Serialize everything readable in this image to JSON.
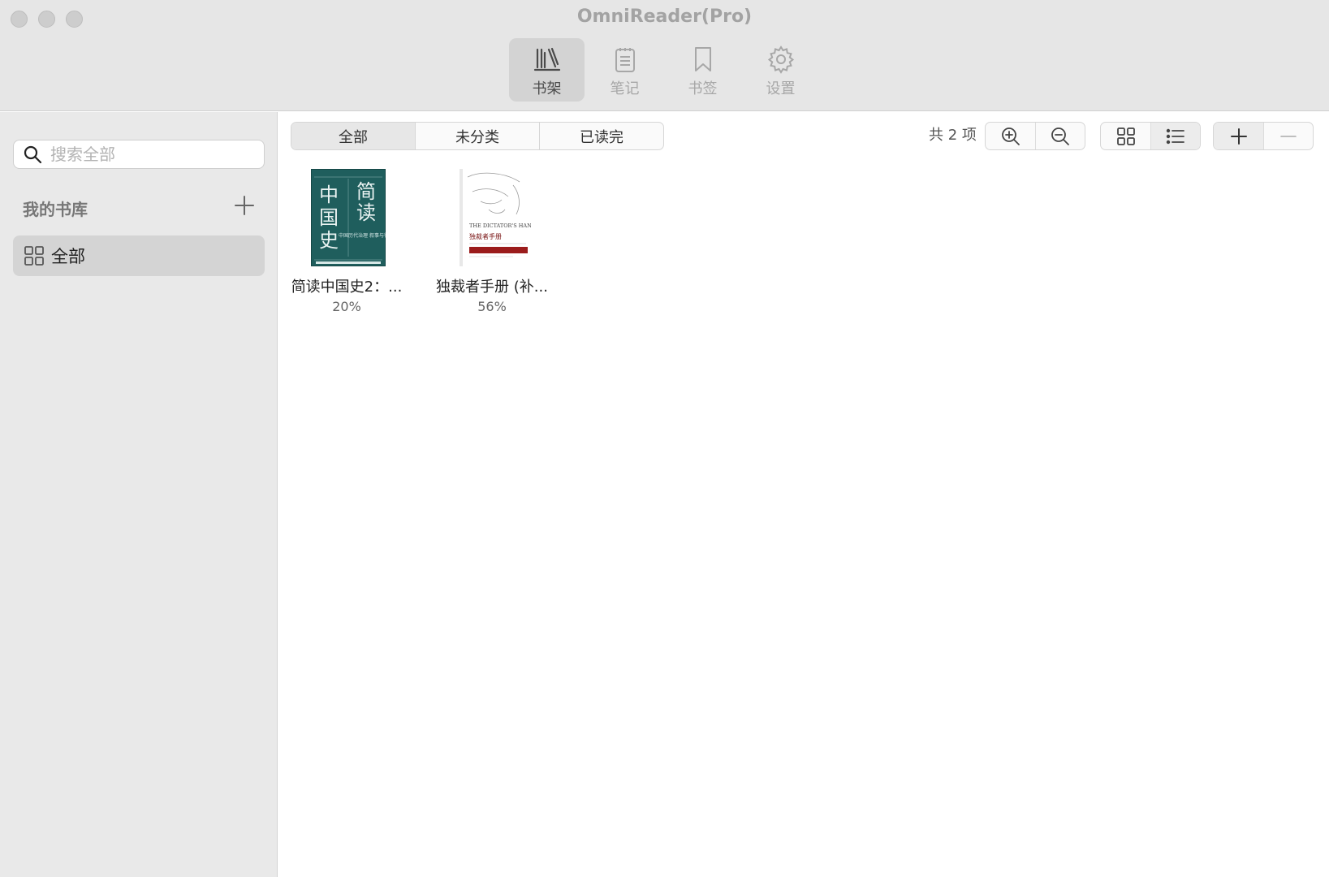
{
  "window": {
    "title": "OmniReader(Pro)"
  },
  "toolbar": {
    "tabs": [
      {
        "label": "书架",
        "icon": "bookshelf-icon",
        "active": true
      },
      {
        "label": "笔记",
        "icon": "notes-icon",
        "active": false
      },
      {
        "label": "书签",
        "icon": "bookmark-icon",
        "active": false
      },
      {
        "label": "设置",
        "icon": "gear-icon",
        "active": false
      }
    ]
  },
  "sidebar": {
    "search": {
      "placeholder": "搜索全部",
      "value": ""
    },
    "library_heading": "我的书库",
    "items": [
      {
        "label": "全部",
        "icon": "grid-icon",
        "selected": true
      }
    ]
  },
  "main": {
    "filters": [
      {
        "label": "全部",
        "active": true
      },
      {
        "label": "未分类",
        "active": false
      },
      {
        "label": "已读完",
        "active": false
      }
    ],
    "count_text": "共 2 项",
    "zoom_buttons": [
      "zoom-in-icon",
      "zoom-out-icon"
    ],
    "view_buttons": [
      "grid-view-icon",
      "list-view-icon"
    ],
    "edit_buttons": [
      "plus-icon",
      "minus-icon"
    ],
    "books": [
      {
        "title": "简读中国史2：...",
        "progress": "20%",
        "cover": {
          "bg": "#1e5f5e",
          "big_text": "中国史",
          "big_text2": "简读",
          "small_text": "中国历代治理 叙事与得失"
        }
      },
      {
        "title": "独裁者手册 (补...",
        "progress": "56%",
        "cover": {
          "bg": "#ffffff",
          "en_title": "THE DICTATOR'S HANDBOOK",
          "cn_title": "独裁者手册",
          "accent": "#9b1c1c"
        }
      }
    ]
  },
  "colors": {
    "titlebar_bg": "#e6e6e6",
    "sidebar_bg": "#e9e9e9",
    "selection_bg": "#d4d4d4"
  }
}
